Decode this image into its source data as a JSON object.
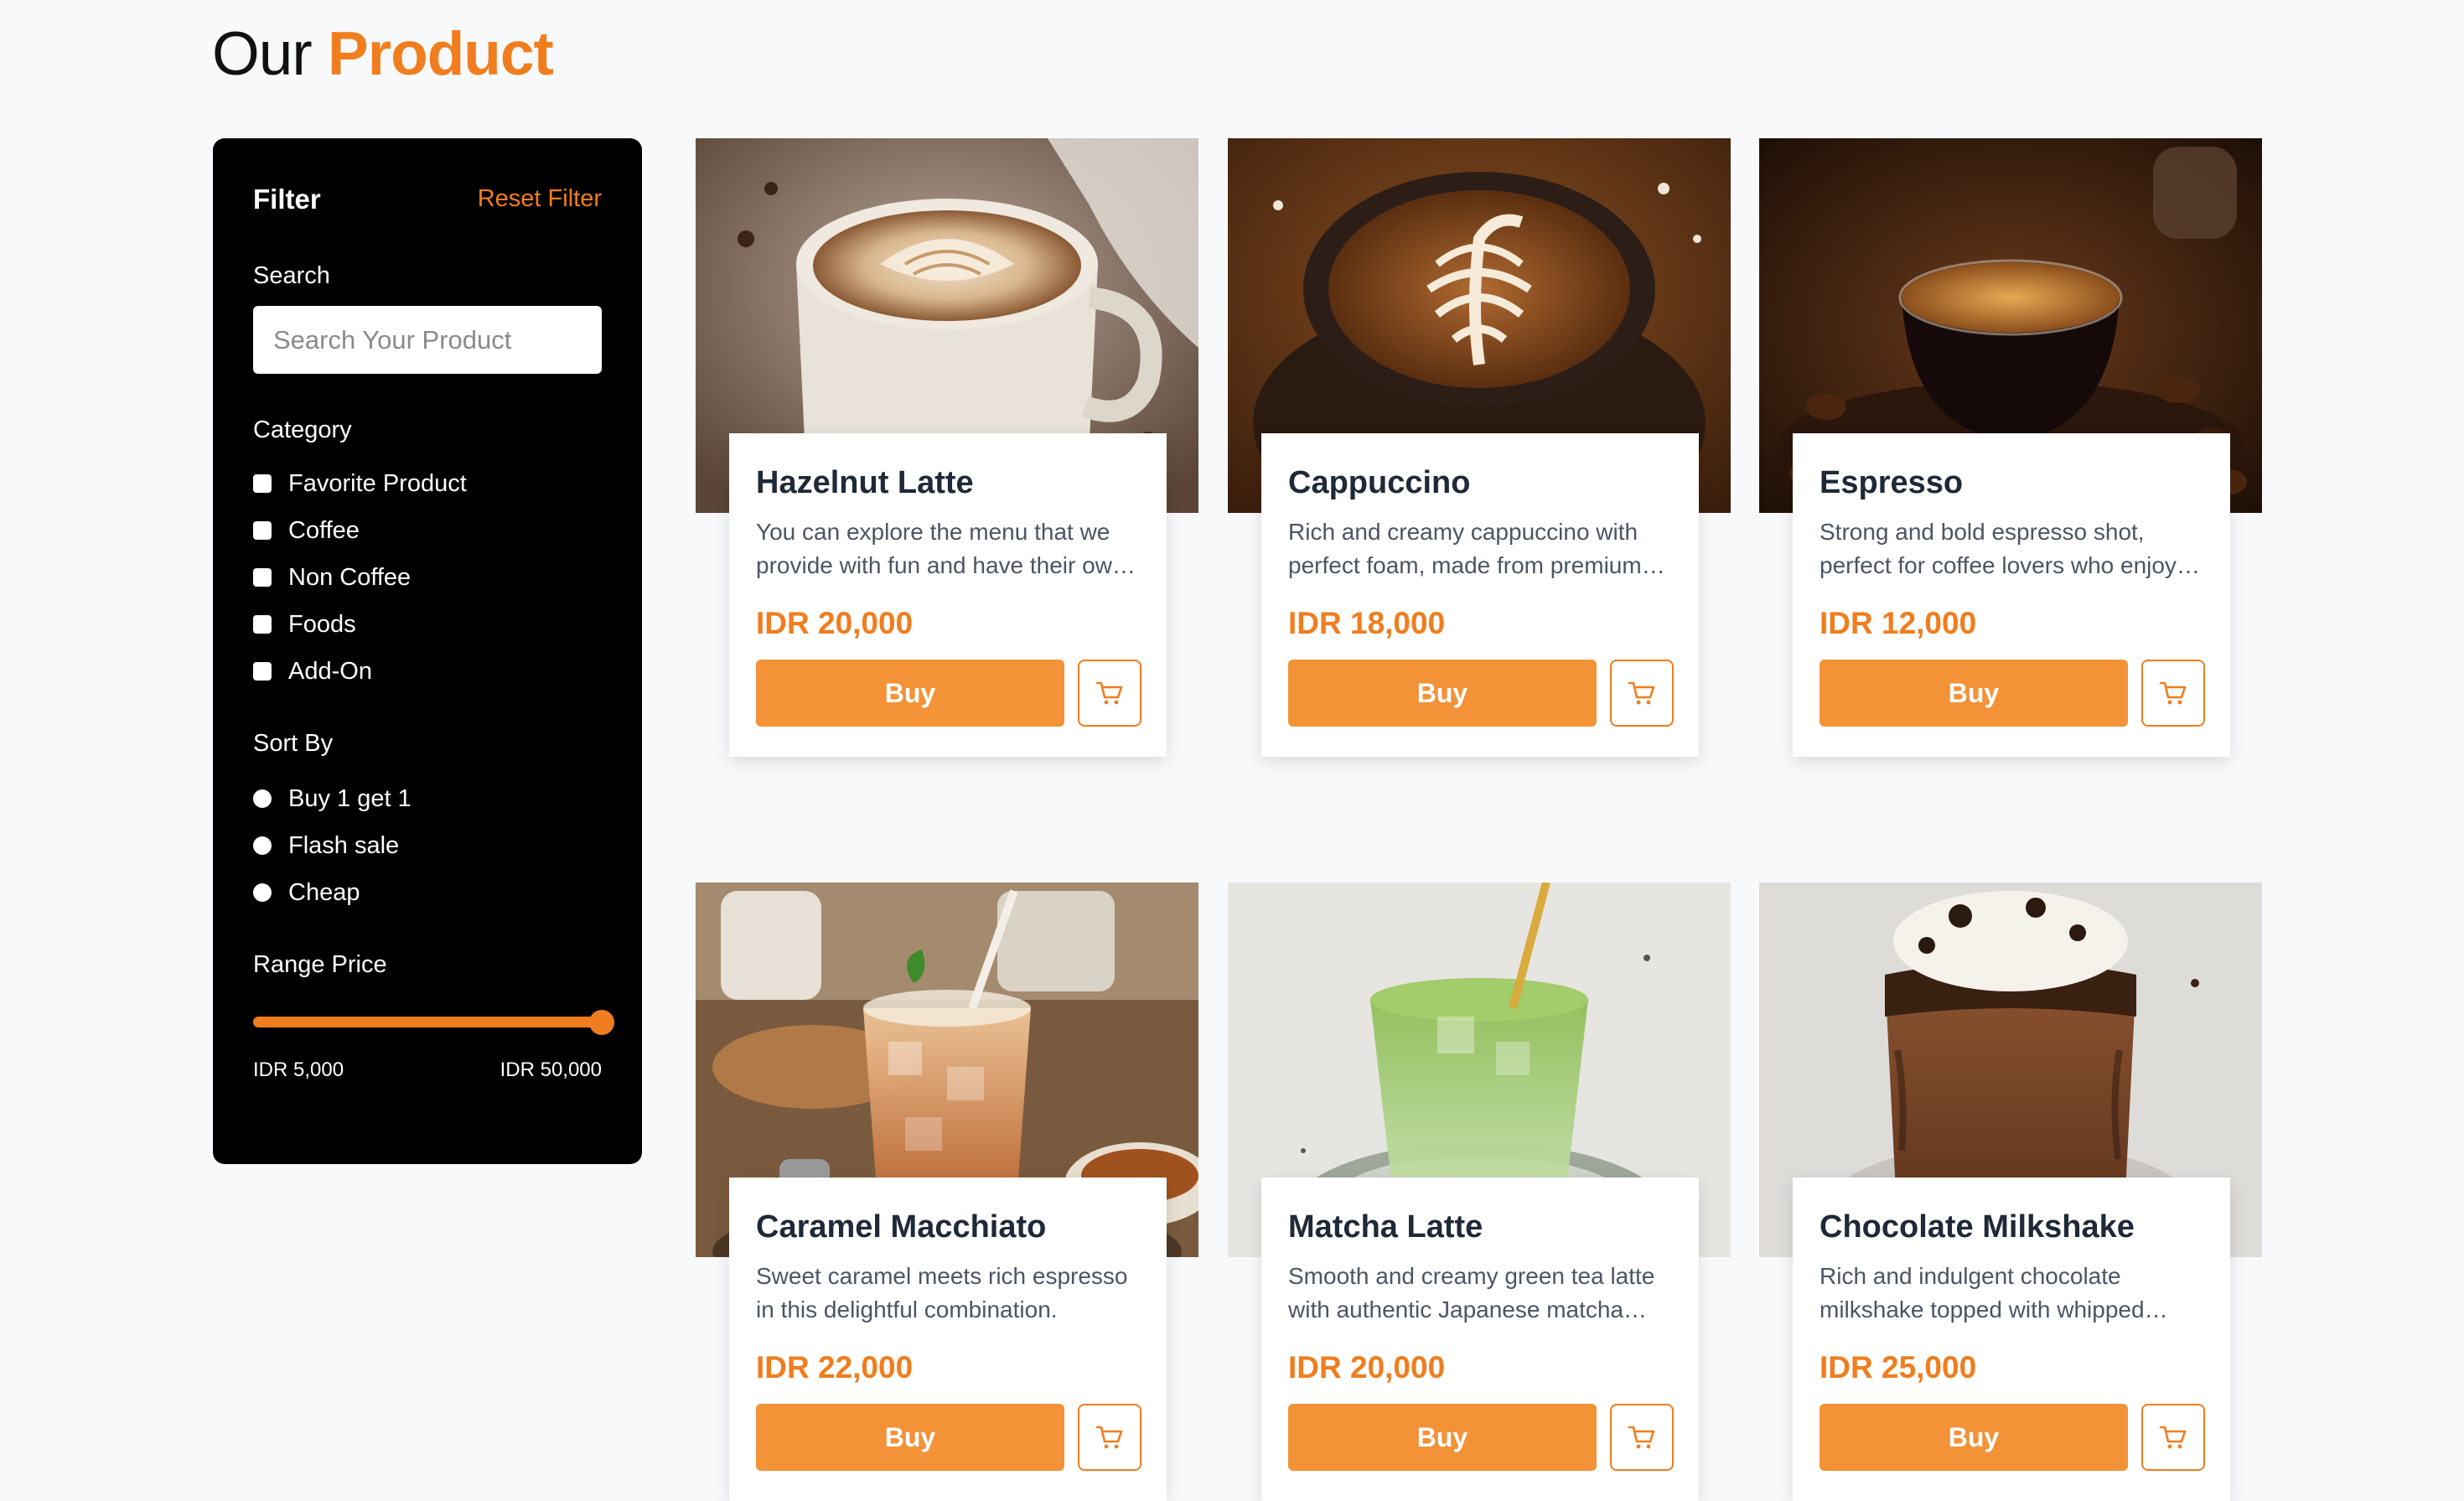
{
  "page": {
    "title_prefix": "Our",
    "title_accent": "Product"
  },
  "colors": {
    "accent": "#f07d1e",
    "button": "#f39237",
    "sidebar_bg": "#000000",
    "page_bg": "#f8f9fb"
  },
  "filter": {
    "title": "Filter",
    "reset_label": "Reset Filter",
    "search_label": "Search",
    "search_placeholder": "Search Your Product",
    "search_value": "",
    "category_label": "Category",
    "categories": [
      "Favorite Product",
      "Coffee",
      "Non Coffee",
      "Foods",
      "Add-On"
    ],
    "sort_label": "Sort By",
    "sort_options": [
      "Buy 1 get 1",
      "Flash sale",
      "Cheap"
    ],
    "range_label": "Range Price",
    "range_min_label": "IDR 5,000",
    "range_max_label": "IDR 50,000",
    "range_value_fraction": 1.0
  },
  "products": [
    {
      "name": "Hazelnut Latte",
      "description": "You can explore the menu that we provide with fun and have their own taste",
      "price": "IDR 20,000",
      "buy_label": "Buy",
      "image": "latte-art-cup"
    },
    {
      "name": "Cappuccino",
      "description": "Rich and creamy cappuccino with perfect foam, made from premium beans",
      "price": "IDR 18,000",
      "buy_label": "Buy",
      "image": "cappuccino-cup"
    },
    {
      "name": "Espresso",
      "description": "Strong and bold espresso shot, perfect for coffee lovers who enjoy intensity",
      "price": "IDR 12,000",
      "buy_label": "Buy",
      "image": "espresso-glass"
    },
    {
      "name": "Caramel Macchiato",
      "description": "Sweet caramel meets rich espresso in this delightful combination.",
      "price": "IDR 22,000",
      "buy_label": "Buy",
      "image": "iced-caramel-glass"
    },
    {
      "name": "Matcha Latte",
      "description": "Smooth and creamy green tea latte with authentic Japanese matcha powder",
      "price": "IDR 20,000",
      "buy_label": "Buy",
      "image": "iced-matcha-glass"
    },
    {
      "name": "Chocolate Milkshake",
      "description": "Rich and indulgent chocolate milkshake topped with whipped cream",
      "price": "IDR 25,000",
      "buy_label": "Buy",
      "image": "chocolate-shake-jar"
    }
  ]
}
